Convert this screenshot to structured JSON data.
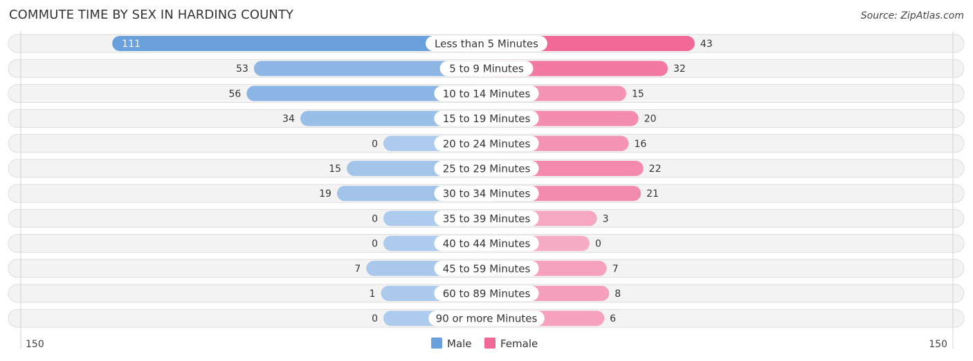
{
  "chart_data": {
    "type": "bar",
    "orientation": "horizontal-diverging",
    "title": "COMMUTE TIME BY SEX IN HARDING COUNTY",
    "source": "Source: ZipAtlas.com",
    "categories": [
      "Less than 5 Minutes",
      "5 to 9 Minutes",
      "10 to 14 Minutes",
      "15 to 19 Minutes",
      "20 to 24 Minutes",
      "25 to 29 Minutes",
      "30 to 34 Minutes",
      "35 to 39 Minutes",
      "40 to 44 Minutes",
      "45 to 59 Minutes",
      "60 to 89 Minutes",
      "90 or more Minutes"
    ],
    "series": [
      {
        "name": "Male",
        "color": "#6aa0dc",
        "values": [
          111,
          53,
          56,
          34,
          0,
          15,
          19,
          0,
          0,
          7,
          1,
          0
        ]
      },
      {
        "name": "Female",
        "color": "#f06896",
        "values": [
          43,
          32,
          15,
          20,
          16,
          22,
          21,
          3,
          0,
          7,
          8,
          6
        ]
      }
    ],
    "axis": {
      "left_label": "150",
      "right_label": "150",
      "max": 150
    },
    "legend": {
      "position": "bottom-center",
      "items": [
        "Male",
        "Female"
      ]
    },
    "xlabel": "",
    "ylabel": ""
  }
}
